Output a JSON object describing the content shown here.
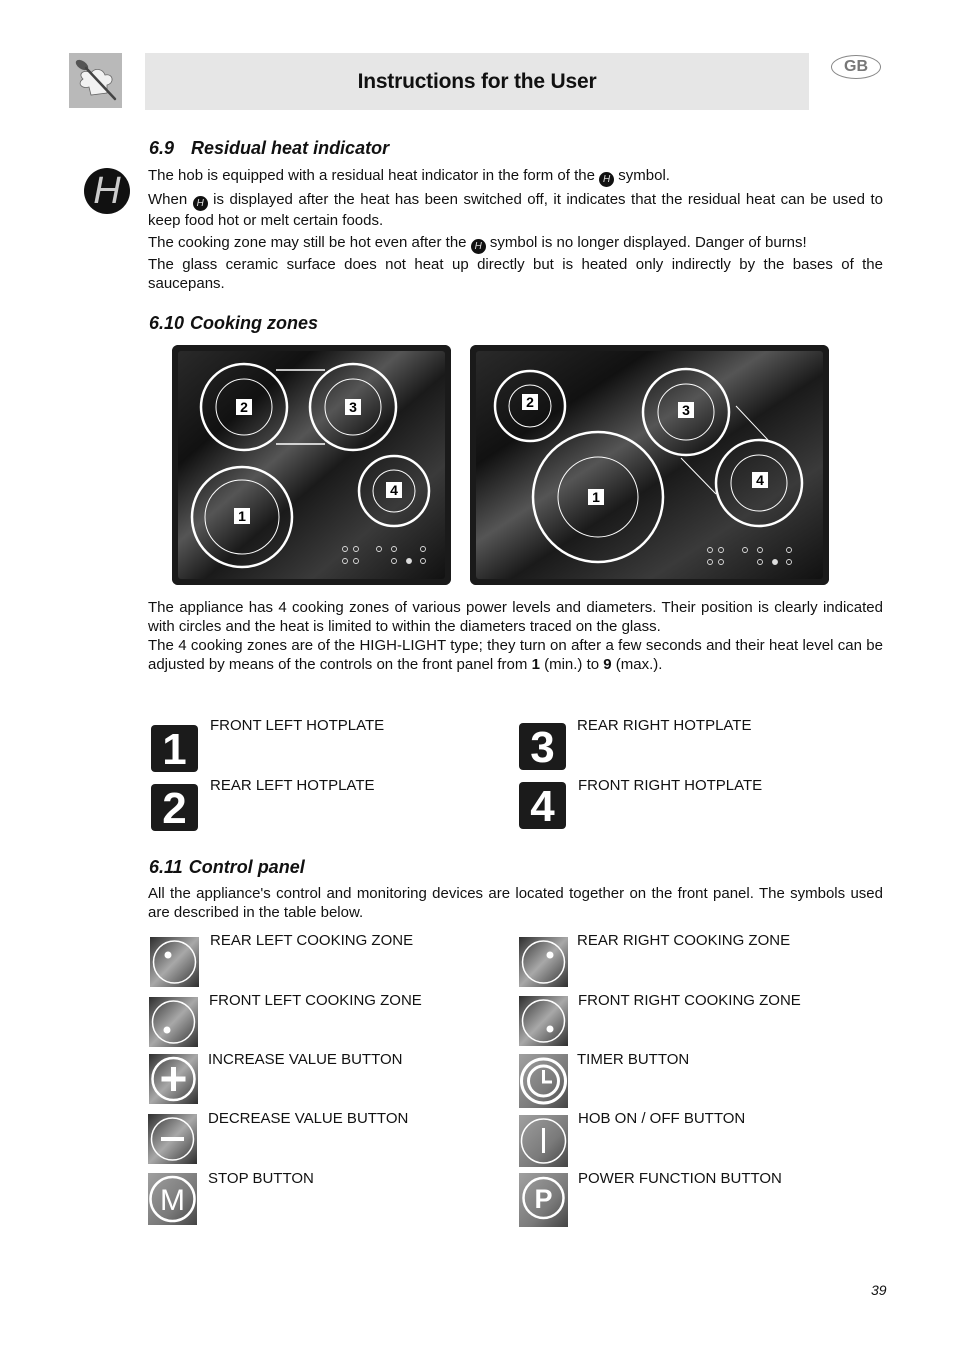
{
  "header": {
    "title": "Instructions for the User",
    "language_badge": "GB",
    "logo_icon": "chef-hat-spoon-icon"
  },
  "section_6_9": {
    "number": "6.9",
    "title": "Residual heat indicator",
    "icon": "residual-heat-H-icon",
    "inline_symbol": "H",
    "p1_before": "The hob is equipped with a residual heat indicator in the form of the ",
    "p1_after": " symbol.",
    "p2_before": "When ",
    "p2_after": " is displayed after the heat has been switched off, it indicates that the residual heat can be used to keep food hot or melt certain foods.",
    "p3_before": "The cooking zone may still be hot even after the ",
    "p3_after": " symbol is no longer displayed. Danger of burns!",
    "p4": "The glass ceramic surface does not heat up directly but is heated only indirectly by the bases of the saucepans."
  },
  "section_6_10": {
    "number": "6.10",
    "title": "Cooking zones",
    "hob_left_zone_labels": [
      "1",
      "2",
      "3",
      "4"
    ],
    "hob_right_zone_labels": [
      "1",
      "2",
      "3",
      "4"
    ],
    "p1": "The appliance has 4 cooking zones of various power levels and diameters. Their position is clearly indicated with circles and the heat is limited to within the diameters traced on the glass.",
    "p2_before": "The 4 cooking zones are of the HIGH-LIGHT type; they turn on after a few seconds and their heat level can be adjusted by means of the controls on the front panel from ",
    "p2_min_value": "1",
    "p2_min_label": " (min.) to ",
    "p2_max_value": "9",
    "p2_max_label": " (max.).",
    "legend": [
      {
        "number": "1",
        "label": "FRONT LEFT HOTPLATE"
      },
      {
        "number": "2",
        "label": "REAR LEFT HOTPLATE"
      },
      {
        "number": "3",
        "label": "REAR RIGHT HOTPLATE"
      },
      {
        "number": "4",
        "label": "FRONT RIGHT HOTPLATE"
      }
    ]
  },
  "section_6_11": {
    "number": "6.11",
    "title": "Control panel",
    "intro": "All the appliance's control and monitoring devices are located together on the front panel. The symbols used are described in the table below.",
    "controls_left": [
      {
        "icon": "rear-left-zone-icon",
        "label": "REAR LEFT COOKING ZONE"
      },
      {
        "icon": "front-left-zone-icon",
        "label": "FRONT LEFT COOKING ZONE"
      },
      {
        "icon": "plus-icon",
        "label": "INCREASE VALUE BUTTON"
      },
      {
        "icon": "minus-icon",
        "label": "DECREASE VALUE BUTTON"
      },
      {
        "icon": "m-stop-icon",
        "label": "STOP BUTTON"
      }
    ],
    "controls_right": [
      {
        "icon": "rear-right-zone-icon",
        "label": "REAR RIGHT COOKING ZONE"
      },
      {
        "icon": "front-right-zone-icon",
        "label": "FRONT RIGHT COOKING ZONE"
      },
      {
        "icon": "clock-icon",
        "label": "TIMER BUTTON"
      },
      {
        "icon": "power-on-off-icon",
        "label": "HOB ON / OFF BUTTON"
      },
      {
        "icon": "p-power-icon",
        "label": "POWER FUNCTION BUTTON"
      }
    ]
  },
  "footer": {
    "page_number": "39"
  }
}
